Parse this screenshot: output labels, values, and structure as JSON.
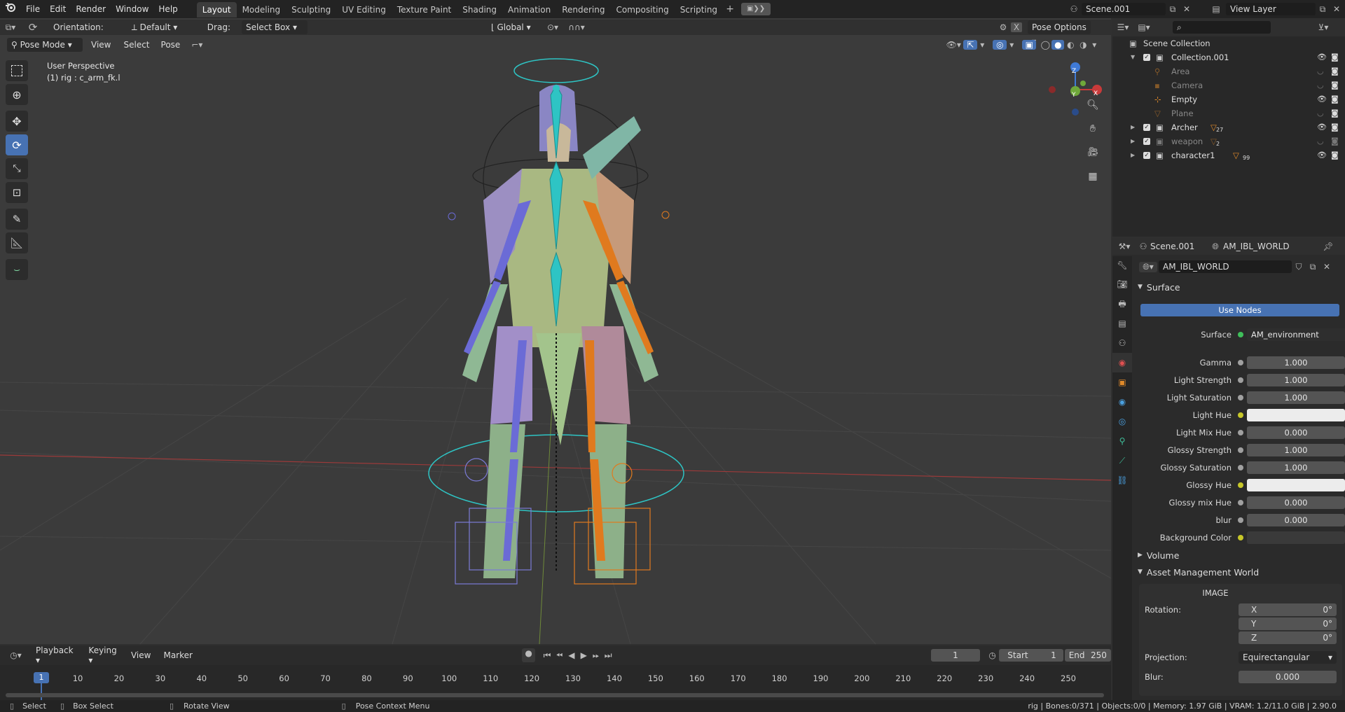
{
  "menu": {
    "logo": "blender-logo-icon",
    "items": [
      "File",
      "Edit",
      "Render",
      "Window",
      "Help"
    ]
  },
  "workspaces": [
    "Layout",
    "Modeling",
    "Sculpting",
    "UV Editing",
    "Texture Paint",
    "Shading",
    "Animation",
    "Rendering",
    "Compositing",
    "Scripting"
  ],
  "workspace_active": "Layout",
  "scene": {
    "name": "Scene.001",
    "view_layer": "View Layer"
  },
  "tool_header": {
    "orientation_label": "Orientation:",
    "orientation_value": "Default",
    "drag_label": "Drag:",
    "drag_value": "Select Box",
    "transform_orientation": "Global",
    "pose_options": "Pose Options"
  },
  "viewport_header": {
    "mode": "Pose Mode",
    "menus": [
      "View",
      "Select",
      "Pose"
    ]
  },
  "viewport": {
    "perspective": "User Perspective",
    "active_bone": "(1) rig : c_arm_fk.l",
    "gizmo": {
      "x": "X",
      "y": "Y",
      "z": "Z"
    }
  },
  "outliner": {
    "search_placeholder": "",
    "root": "Scene Collection",
    "rows": [
      {
        "name": "Collection.001",
        "dim": false
      },
      {
        "name": "Area",
        "dim": true
      },
      {
        "name": "Camera",
        "dim": true
      },
      {
        "name": "Empty",
        "dim": false
      },
      {
        "name": "Plane",
        "dim": true
      },
      {
        "name": "Archer",
        "dim": false,
        "badge": "27"
      },
      {
        "name": "weapon",
        "dim": true,
        "badge": "2"
      },
      {
        "name": "character1",
        "dim": false,
        "badge": "99"
      }
    ]
  },
  "properties": {
    "header_scene": "Scene.001",
    "header_world": "AM_IBL_WORLD",
    "world_name": "AM_IBL_WORLD",
    "surface_panel": "Surface",
    "use_nodes": "Use Nodes",
    "surface_label": "Surface",
    "surface_value": "AM_environment",
    "inputs": [
      {
        "label": "Gamma",
        "value": "1.000",
        "type": "num"
      },
      {
        "label": "Light Strength",
        "value": "1.000",
        "type": "num"
      },
      {
        "label": "Light Saturation",
        "value": "1.000",
        "type": "num"
      },
      {
        "label": "Light Hue",
        "value": "",
        "type": "color"
      },
      {
        "label": "Light Mix Hue",
        "value": "0.000",
        "type": "num"
      },
      {
        "label": "Glossy Strength",
        "value": "1.000",
        "type": "num"
      },
      {
        "label": "Glossy Saturation",
        "value": "1.000",
        "type": "num"
      },
      {
        "label": "Glossy Hue",
        "value": "",
        "type": "color"
      },
      {
        "label": "Glossy mix Hue",
        "value": "0.000",
        "type": "num"
      },
      {
        "label": "blur",
        "value": "0.000",
        "type": "num"
      },
      {
        "label": "Background Color",
        "value": "",
        "type": "dark"
      }
    ],
    "volume_panel": "Volume",
    "asset_panel": "Asset Management World",
    "image_label": "IMAGE",
    "rotation_label": "Rotation:",
    "rotation": [
      {
        "axis": "X",
        "value": "0°"
      },
      {
        "axis": "Y",
        "value": "0°"
      },
      {
        "axis": "Z",
        "value": "0°"
      }
    ],
    "projection_label": "Projection:",
    "projection_value": "Equirectangular",
    "blur_label": "Blur:",
    "blur_value": "0.000"
  },
  "timeline": {
    "menus": [
      "Playback",
      "Keying",
      "View",
      "Marker"
    ],
    "current_frame": "1",
    "start_label": "Start",
    "start_value": "1",
    "end_label": "End",
    "end_value": "250",
    "ticks": [
      "1",
      "10",
      "20",
      "30",
      "40",
      "50",
      "60",
      "70",
      "80",
      "90",
      "100",
      "110",
      "120",
      "130",
      "140",
      "150",
      "160",
      "170",
      "180",
      "190",
      "200",
      "210",
      "220",
      "230",
      "240",
      "250"
    ]
  },
  "statusbar": {
    "select": "Select",
    "box_select": "Box Select",
    "rotate_view": "Rotate View",
    "context_menu": "Pose Context Menu",
    "stats": "rig | Bones:0/371 | Objects:0/0 | Memory: 1.97 GiB | VRAM: 1.2/11.0 GiB | 2.90.0"
  },
  "colors": {
    "accent": "#4772b3",
    "bone_left": "#6b6bd6",
    "bone_right": "#e07a1e",
    "bone_center": "#2ec4c4",
    "x_axis": "#c93a3a",
    "y_axis": "#6fa83a",
    "z_axis": "#3f7ad6"
  }
}
